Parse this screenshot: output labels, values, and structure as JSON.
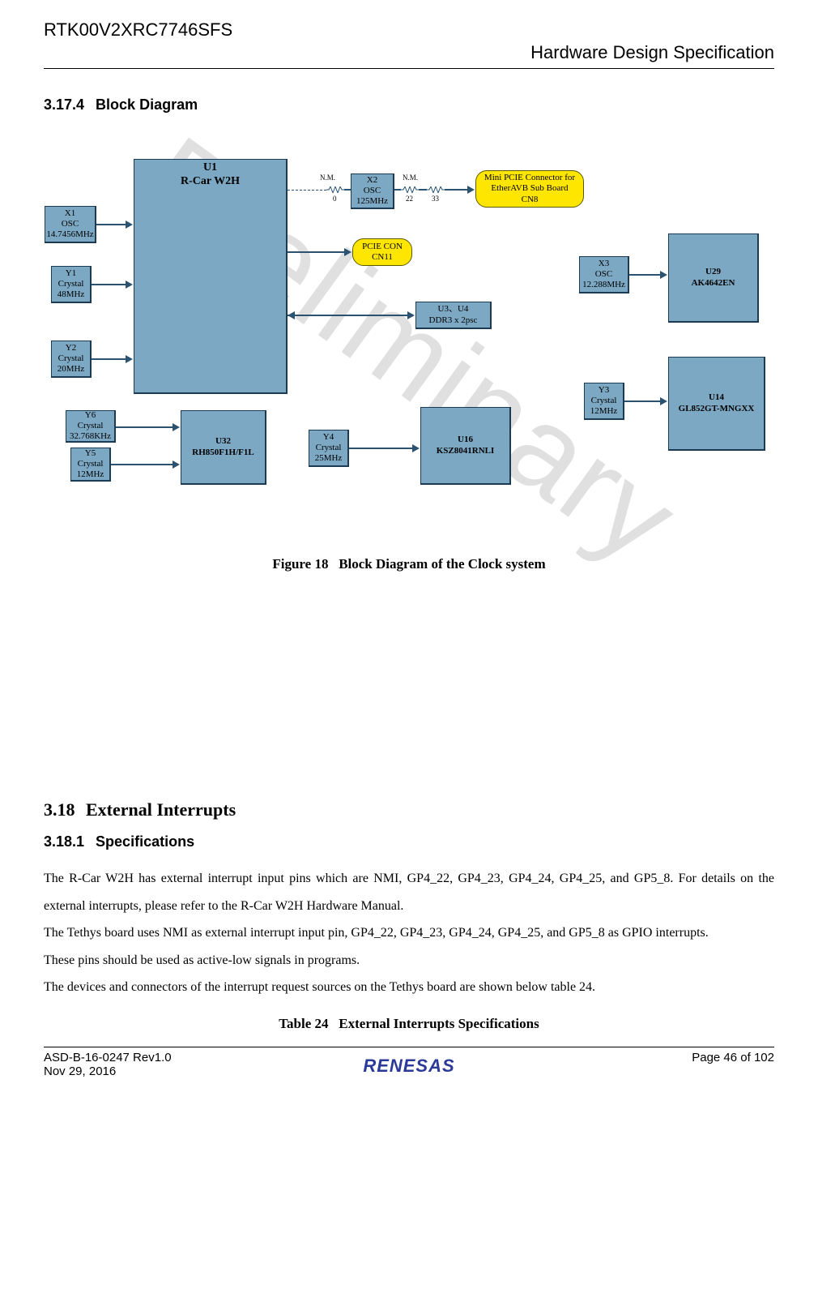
{
  "header": {
    "code": "RTK00V2XRC7746SFS",
    "title": "Hardware Design Specification"
  },
  "section_block_diagram": {
    "num": "3.17.4",
    "title": "Block Diagram"
  },
  "figure": {
    "caption_label": "Figure 18",
    "caption_text": "Block Diagram of the Clock system"
  },
  "watermark": "Preliminary",
  "blocks": {
    "u1_l1": "U1",
    "u1_l2": "R-Car W2H",
    "x1_l1": "X1",
    "x1_l2": "OSC",
    "x1_l3": "14.7456MHz",
    "y1_l1": "Y1",
    "y1_l2": "Crystal",
    "y1_l3": "48MHz",
    "y2_l1": "Y2",
    "y2_l2": "Crystal",
    "y2_l3": "20MHz",
    "x2_l1": "X2",
    "x2_l2": "OSC",
    "x2_l3": "125MHz",
    "pcie_l1": "PCIE CON",
    "pcie_l2": "CN11",
    "u3u4_l1": "U3、U4",
    "u3u4_l2": "DDR3 x 2psc",
    "mini_l1": "Mini PCIE Connector for",
    "mini_l2": "EtherAVB Sub Board",
    "mini_l3": "CN8",
    "x3_l1": "X3",
    "x3_l2": "OSC",
    "x3_l3": "12.288MHz",
    "u29_l1": "U29",
    "u29_l2": "AK4642EN",
    "y3_l1": "Y3",
    "y3_l2": "Crystal",
    "y3_l3": "12MHz",
    "u14_l1": "U14",
    "u14_l2": "GL852GT-MNGXX",
    "y6_l1": "Y6",
    "y6_l2": "Crystal",
    "y6_l3": "32.768KHz",
    "y5_l1": "Y5",
    "y5_l2": "Crystal",
    "y5_l3": "12MHz",
    "u32_l1": "U32",
    "u32_l2": "RH850F1H/F1L",
    "y4_l1": "Y4",
    "y4_l2": "Crystal",
    "y4_l3": "25MHz",
    "u16_l1": "U16",
    "u16_l2": "KSZ8041RNLI"
  },
  "res": {
    "nm": "N.M.",
    "r0": "0",
    "r22": "22",
    "r33": "33"
  },
  "section_ext_int": {
    "num": "3.18",
    "title": "External Interrupts"
  },
  "section_spec": {
    "num": "3.18.1",
    "title": "Specifications"
  },
  "body": {
    "p1": "The R-Car W2H has external interrupt input pins which are NMI, GP4_22, GP4_23, GP4_24, GP4_25, and GP5_8. For details on the external interrupts, please refer to the R-Car W2H Hardware Manual.",
    "p2": "The Tethys board uses NMI as external interrupt input pin, GP4_22, GP4_23, GP4_24, GP4_25, and GP5_8 as GPIO interrupts.",
    "p3": "These pins should be used as active-low signals in programs.",
    "p4": "The devices and connectors of the interrupt request sources on the Tethys board are shown below table 24."
  },
  "table_caption": {
    "label": "Table 24",
    "text": "External Interrupts Specifications"
  },
  "footer": {
    "doc": "ASD-B-16-0247   Rev1.0",
    "date": "Nov 29, 2016",
    "page": "Page  46  of 102",
    "logo": "RENESAS"
  }
}
